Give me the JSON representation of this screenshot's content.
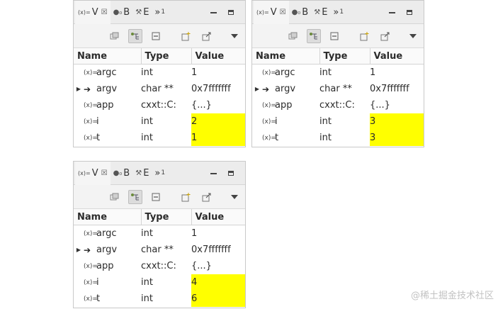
{
  "panels": [
    {
      "tabs": [
        {
          "icon": "(x)=",
          "label": "V",
          "close": "☒",
          "active": true
        },
        {
          "icon": "●₀",
          "label": "B",
          "active": false
        },
        {
          "icon": "⚒",
          "label": "E",
          "active": false
        },
        {
          "icon": "»",
          "label": "1",
          "active": false
        }
      ],
      "columns": [
        "Name",
        "Type",
        "Value"
      ],
      "rows": [
        {
          "name": "argc",
          "icon": "(x)=",
          "expandable": false,
          "type": "int",
          "value": "1",
          "changed": false
        },
        {
          "name": "argv",
          "icon": "➔",
          "expandable": true,
          "type": "char **",
          "value": "0x7fffffff",
          "changed": false
        },
        {
          "name": "app",
          "icon": "(x)=",
          "expandable": false,
          "type": "cxxt::C:",
          "value": "{...}",
          "changed": false
        },
        {
          "name": "i",
          "icon": "(x)=",
          "expandable": false,
          "type": "int",
          "value": "2",
          "changed": true
        },
        {
          "name": "t",
          "icon": "(x)=",
          "expandable": false,
          "type": "int",
          "value": "1",
          "changed": true
        }
      ]
    },
    {
      "tabs": [
        {
          "icon": "(x)=",
          "label": "V",
          "close": "☒",
          "active": true
        },
        {
          "icon": "●₀",
          "label": "B",
          "active": false
        },
        {
          "icon": "⚒",
          "label": "E",
          "active": false
        },
        {
          "icon": "»",
          "label": "1",
          "active": false
        }
      ],
      "columns": [
        "Name",
        "Type",
        "Value"
      ],
      "rows": [
        {
          "name": "argc",
          "icon": "(x)=",
          "expandable": false,
          "type": "int",
          "value": "1",
          "changed": false
        },
        {
          "name": "argv",
          "icon": "➔",
          "expandable": true,
          "type": "char **",
          "value": "0x7fffffff",
          "changed": false
        },
        {
          "name": "app",
          "icon": "(x)=",
          "expandable": false,
          "type": "cxxt::C:",
          "value": "{...}",
          "changed": false
        },
        {
          "name": "i",
          "icon": "(x)=",
          "expandable": false,
          "type": "int",
          "value": "3",
          "changed": true
        },
        {
          "name": "t",
          "icon": "(x)=",
          "expandable": false,
          "type": "int",
          "value": "3",
          "changed": true
        }
      ]
    },
    {
      "tabs": [
        {
          "icon": "(x)=",
          "label": "V",
          "close": "☒",
          "active": true
        },
        {
          "icon": "●₀",
          "label": "B",
          "active": false
        },
        {
          "icon": "⚒",
          "label": "E",
          "active": false
        },
        {
          "icon": "»",
          "label": "1",
          "active": false
        }
      ],
      "columns": [
        "Name",
        "Type",
        "Value"
      ],
      "rows": [
        {
          "name": "argc",
          "icon": "(x)=",
          "expandable": false,
          "type": "int",
          "value": "1",
          "changed": false
        },
        {
          "name": "argv",
          "icon": "➔",
          "expandable": true,
          "type": "char **",
          "value": "0x7fffffff",
          "changed": false
        },
        {
          "name": "app",
          "icon": "(x)=",
          "expandable": false,
          "type": "cxxt::C:",
          "value": "{...}",
          "changed": false
        },
        {
          "name": "i",
          "icon": "(x)=",
          "expandable": false,
          "type": "int",
          "value": "4",
          "changed": true
        },
        {
          "name": "t",
          "icon": "(x)=",
          "expandable": false,
          "type": "int",
          "value": "6",
          "changed": true
        }
      ]
    }
  ],
  "toolbar_icons": [
    "show-type-names-icon",
    "show-logical-structure-icon",
    "collapse-all-icon",
    "add-watch-icon",
    "restore-icon",
    "view-menu-caret-icon"
  ],
  "colors": {
    "changed_highlight": "#ffff00",
    "panel_border": "#c9c9c9"
  },
  "watermark": "@稀土掘金技术社区"
}
